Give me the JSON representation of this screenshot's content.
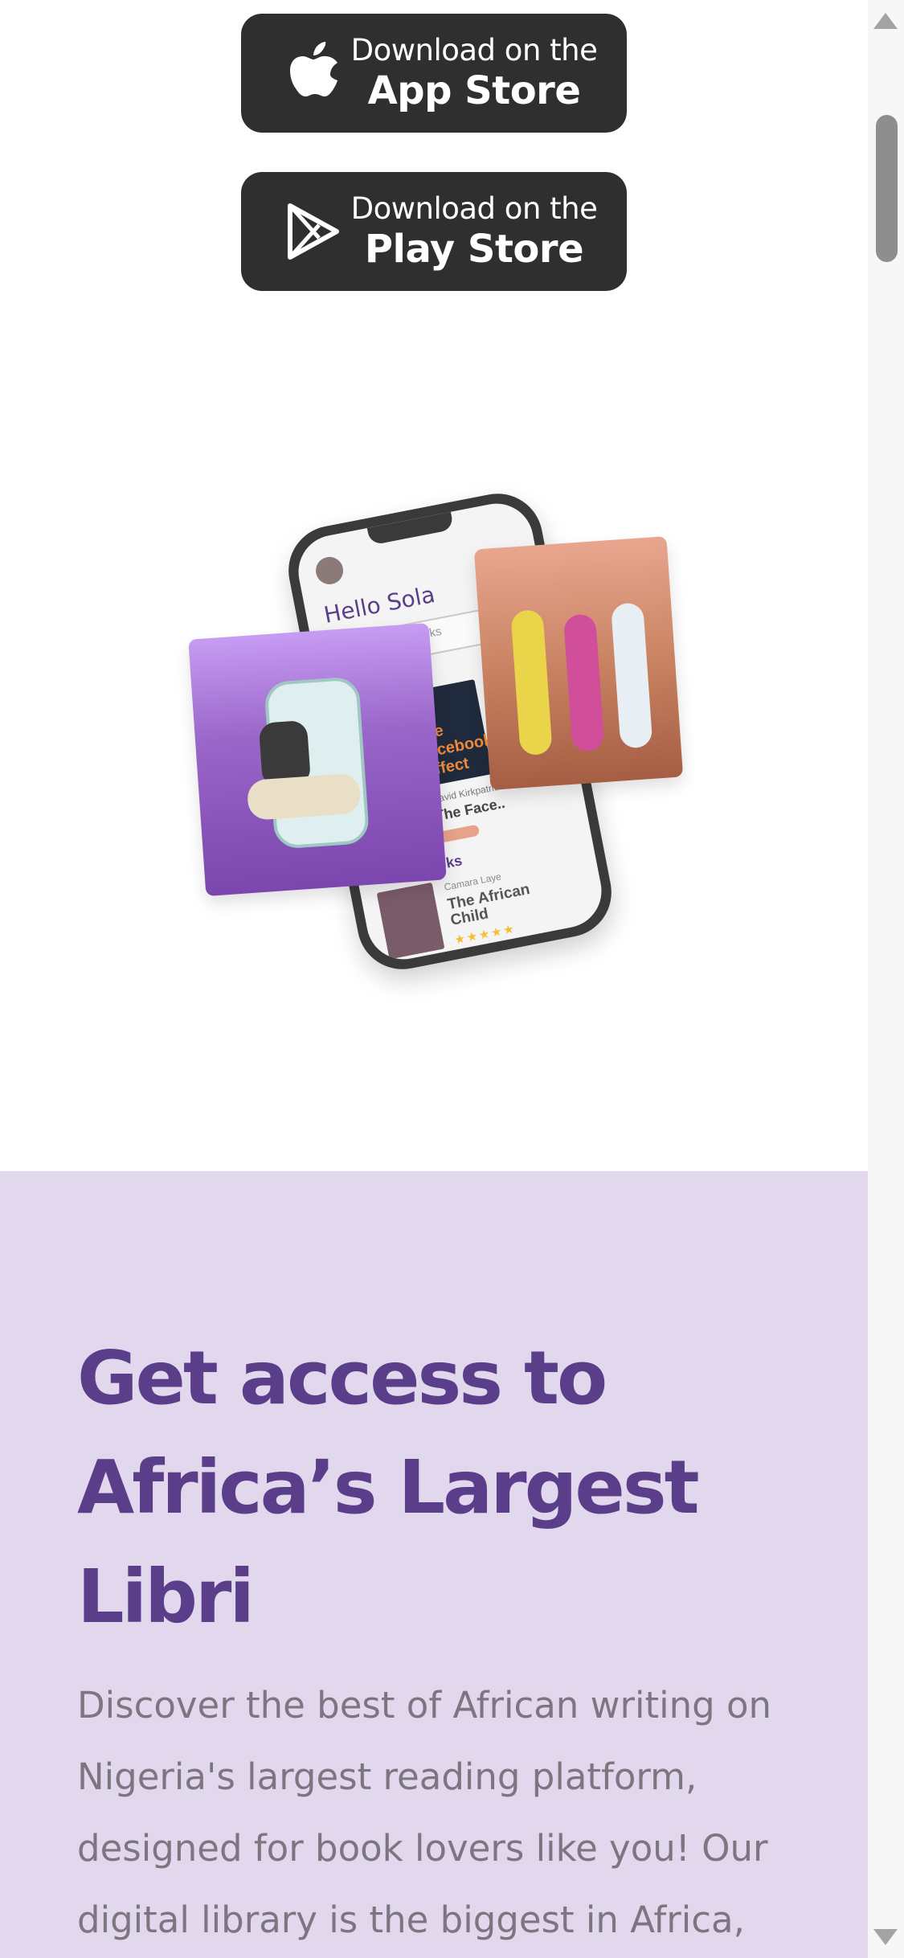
{
  "store_buttons": {
    "app_store": {
      "line1": "Download on the",
      "line2": "App Store",
      "icon": "apple-icon"
    },
    "play_store": {
      "line1": "Download on the",
      "line2": "Play Store",
      "icon": "play-store-icon"
    }
  },
  "hero": {
    "phone": {
      "greeting": "Hello Sola",
      "search_placeholder": "Search Books",
      "book_cover_title": "the facebook effect",
      "book_author": "David Kirkpatrick",
      "book_title": "The Face..",
      "section_title": "ng Books",
      "list_author": "Camara Laye",
      "list_title": "The African Child",
      "rating": "★★★★★"
    }
  },
  "promo": {
    "headline": "Get access to Africa’s Largest Libri",
    "description": "Discover the best of African writing on Nigeria's largest reading platform, designed for book lovers like you! Our digital library is the biggest in Africa,"
  },
  "colors": {
    "button_bg": "#2f2f2f",
    "promo_bg": "#e1d8ee",
    "headline": "#5b3e8a",
    "body_text": "#7d757f"
  }
}
